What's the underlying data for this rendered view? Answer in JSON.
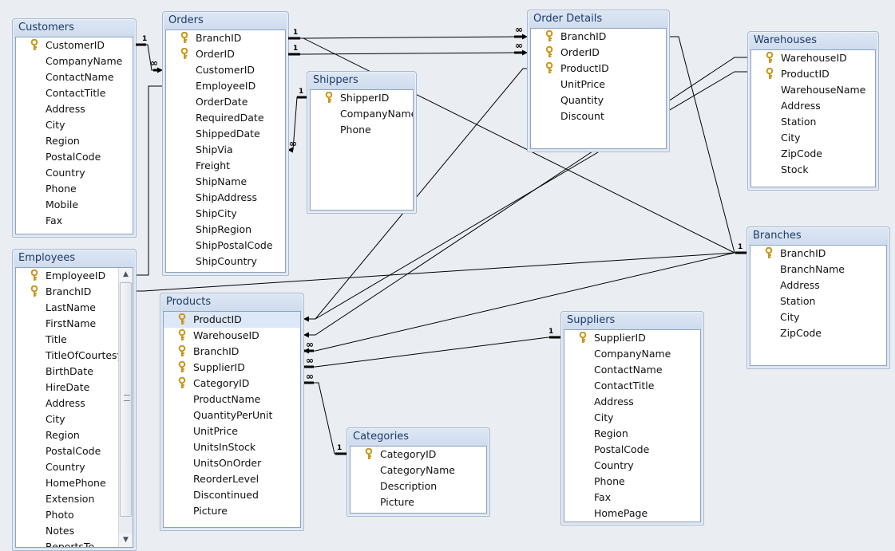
{
  "cardinality": {
    "one": "1",
    "many": "∞"
  },
  "colors": {
    "canvas": "#eaeef3",
    "title_text": "#1e3a68",
    "key": "#d4a017",
    "selected_row": "#dce8f8"
  },
  "tables": [
    {
      "name": "Customers",
      "keys": [
        0
      ],
      "fields": [
        "CustomerID",
        "CompanyName",
        "ContactName",
        "ContactTitle",
        "Address",
        "City",
        "Region",
        "PostalCode",
        "Country",
        "Phone",
        "Mobile",
        "Fax"
      ]
    },
    {
      "name": "Orders",
      "keys": [
        0,
        1
      ],
      "fields": [
        "BranchID",
        "OrderID",
        "CustomerID",
        "EmployeeID",
        "OrderDate",
        "RequiredDate",
        "ShippedDate",
        "ShipVia",
        "Freight",
        "ShipName",
        "ShipAddress",
        "ShipCity",
        "ShipRegion",
        "ShipPostalCode",
        "ShipCountry"
      ]
    },
    {
      "name": "Shippers",
      "keys": [
        0
      ],
      "fields": [
        "ShipperID",
        "CompanyName",
        "Phone"
      ]
    },
    {
      "name": "Order Details",
      "keys": [
        0,
        1,
        2
      ],
      "fields": [
        "BranchID",
        "OrderID",
        "ProductID",
        "UnitPrice",
        "Quantity",
        "Discount"
      ]
    },
    {
      "name": "Warehouses",
      "keys": [
        0,
        1
      ],
      "fields": [
        "WarehouseID",
        "ProductID",
        "WarehouseName",
        "Address",
        "Station",
        "City",
        "ZipCode",
        "Stock"
      ]
    },
    {
      "name": "Branches",
      "keys": [
        0
      ],
      "fields": [
        "BranchID",
        "BranchName",
        "Address",
        "Station",
        "City",
        "ZipCode"
      ]
    },
    {
      "name": "Employees",
      "keys": [
        0,
        1
      ],
      "scrollbar": true,
      "fields": [
        "EmployeeID",
        "BranchID",
        "LastName",
        "FirstName",
        "Title",
        "TitleOfCourtesy",
        "BirthDate",
        "HireDate",
        "Address",
        "City",
        "Region",
        "PostalCode",
        "Country",
        "HomePhone",
        "Extension",
        "Photo",
        "Notes",
        "ReportsTo"
      ]
    },
    {
      "name": "Products",
      "keys": [
        0,
        1,
        2,
        3,
        4
      ],
      "selected": 0,
      "fields": [
        "ProductID",
        "WarehouseID",
        "BranchID",
        "SupplierID",
        "CategoryID",
        "ProductName",
        "QuantityPerUnit",
        "UnitPrice",
        "UnitsInStock",
        "UnitsOnOrder",
        "ReorderLevel",
        "Discontinued",
        "Picture"
      ]
    },
    {
      "name": "Categories",
      "keys": [
        0
      ],
      "fields": [
        "CategoryID",
        "CategoryName",
        "Description",
        "Picture"
      ]
    },
    {
      "name": "Suppliers",
      "keys": [
        0
      ],
      "fields": [
        "SupplierID",
        "CompanyName",
        "ContactName",
        "ContactTitle",
        "Address",
        "City",
        "Region",
        "PostalCode",
        "Country",
        "Phone",
        "Fax",
        "HomePage"
      ]
    }
  ],
  "relationships": [
    {
      "from": "Customers.CustomerID",
      "to": "Orders.CustomerID",
      "enforced": true
    },
    {
      "from": "Employees.EmployeeID",
      "to": "Orders.EmployeeID",
      "enforced": false
    },
    {
      "from": "Orders.BranchID",
      "to": "Order Details.BranchID",
      "enforced": true
    },
    {
      "from": "Orders.OrderID",
      "to": "Order Details.OrderID",
      "enforced": true
    },
    {
      "from": "Branches.BranchID",
      "to": "Orders.BranchID",
      "enforced": false
    },
    {
      "from": "Shippers.ShipperID",
      "to": "Orders.ShipVia",
      "enforced": true
    },
    {
      "from": "Products.ProductID",
      "to": "Order Details.ProductID",
      "enforced": false
    },
    {
      "from": "Warehouses.WarehouseID",
      "to": "Products.WarehouseID",
      "enforced": false
    },
    {
      "from": "Warehouses.ProductID",
      "to": "Products.ProductID",
      "enforced": false
    },
    {
      "from": "Branches.BranchID",
      "to": "Order Details.BranchID",
      "enforced": false
    },
    {
      "from": "Branches.BranchID",
      "to": "Employees.BranchID",
      "enforced": false
    },
    {
      "from": "Branches.BranchID",
      "to": "Products.BranchID",
      "enforced": true
    },
    {
      "from": "Suppliers.SupplierID",
      "to": "Products.SupplierID",
      "enforced": true
    },
    {
      "from": "Categories.CategoryID",
      "to": "Products.CategoryID",
      "enforced": true
    }
  ]
}
